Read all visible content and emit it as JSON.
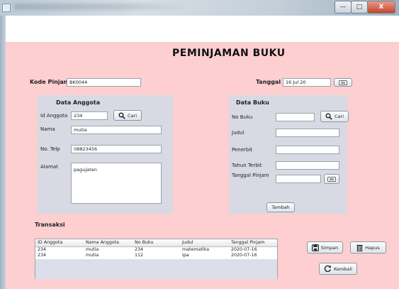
{
  "window": {
    "close_glyph": "X",
    "minimize_glyph": "—",
    "maximize_glyph": "□"
  },
  "title": "PEMINJAMAN BUKU",
  "kode_pinjam": {
    "label": "Kode Pinjam",
    "value": "BK0044"
  },
  "tanggal": {
    "label": "Tanggal",
    "value": "16 Jul 20"
  },
  "anggota": {
    "heading": "Data Anggota",
    "id_label": "Id Anggota",
    "id_value": "234",
    "cari_label": "Cari",
    "nama_label": "Nama",
    "nama_value": "mutia",
    "telp_label": "No. Telp",
    "telp_value": "08823456",
    "alamat_label": "Alamat",
    "alamat_value": "pagujaten"
  },
  "buku": {
    "heading": "Data Buku",
    "no_label": "No Buku",
    "no_value": "",
    "cari_label": "Cari",
    "judul_label": "Judul",
    "judul_value": "",
    "penerbit_label": "Penerbit",
    "penerbit_value": "",
    "tahun_label": "Tahun Terbit",
    "tahun_value": "",
    "tgl_pinjam_label": "Tanggal Pinjam",
    "tgl_pinjam_value": "",
    "tambah_label": "Tambah"
  },
  "transaksi": {
    "heading": "Transaksi",
    "columns": [
      "ID Anggota",
      "Nama Anggota",
      "No Buku",
      "Judul",
      "Tanggal Pinjam"
    ],
    "rows": [
      [
        "234",
        "mutia",
        "234",
        "matematika",
        "2020-07-16"
      ],
      [
        "234",
        "mutia",
        "112",
        "ipa",
        "2020-07-16"
      ]
    ]
  },
  "actions": {
    "simpan": "Simpan",
    "hapus": "Hapus",
    "kembali": "Kembali"
  },
  "colors": {
    "panel_bg": "#fdcfd0",
    "group_bg": "#d8d9e3",
    "accent": "#2f5f8f"
  }
}
